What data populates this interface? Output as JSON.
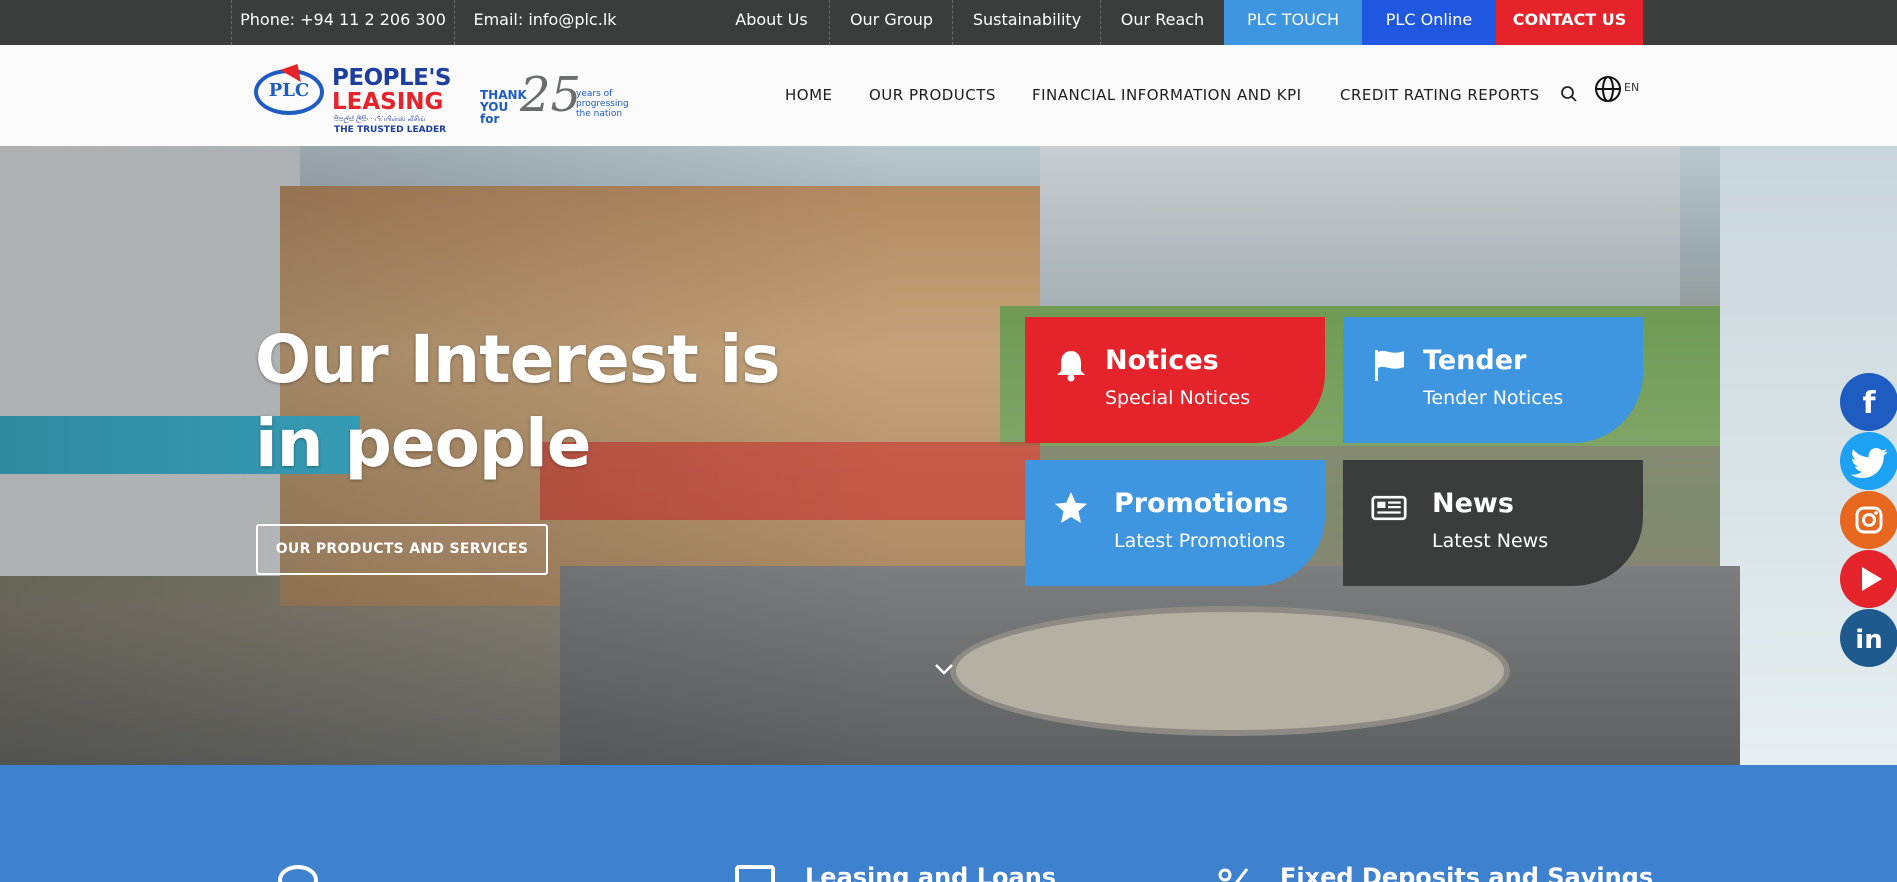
{
  "topbar": {
    "phone": "Phone: +94 11 2 206 300",
    "email": "Email: info@plc.lk",
    "links": [
      "About Us",
      "Our Group",
      "Sustainability",
      "Our Reach"
    ],
    "plc_touch": "PLC TOUCH",
    "plc_online": "PLC Online",
    "contact": "CONTACT US"
  },
  "logo": {
    "circle": "PLC",
    "name1": "PEOPLE'S",
    "name2": "LEASING",
    "sinhala": "පීපල්ස් ලීසිං · பீப்பிள்ஸ் லீசிங்",
    "tagline": "THE TRUSTED LEADER"
  },
  "anniversary": {
    "thank": "THANK YOU for",
    "number": "25",
    "years": "years of progressing the nation"
  },
  "nav": {
    "home": "HOME",
    "products": "OUR PRODUCTS",
    "financial": "FINANCIAL INFORMATION AND KPI",
    "credit": "CREDIT RATING REPORTS",
    "lang": "EN"
  },
  "hero": {
    "title": "Our Interest is in people",
    "button": "OUR PRODUCTS AND SERVICES"
  },
  "tiles": [
    {
      "title": "Notices",
      "subtitle": "Special Notices",
      "icon": "bell-icon"
    },
    {
      "title": "Tender",
      "subtitle": "Tender Notices",
      "icon": "flag-icon"
    },
    {
      "title": "Promotions",
      "subtitle": "Latest Promotions",
      "icon": "star-icon"
    },
    {
      "title": "News",
      "subtitle": "Latest News",
      "icon": "newspaper-icon"
    }
  ],
  "social": [
    "f",
    "t",
    "ig",
    "yt",
    "in"
  ],
  "features": [
    "Leasing and Loans",
    "Fixed Deposits and Savings"
  ],
  "colors": {
    "topbar": "#3a3d3c",
    "red": "#e5232b",
    "blue": "#3e95e0",
    "dark_blue": "#1f57e0",
    "band": "#3e82cf"
  }
}
